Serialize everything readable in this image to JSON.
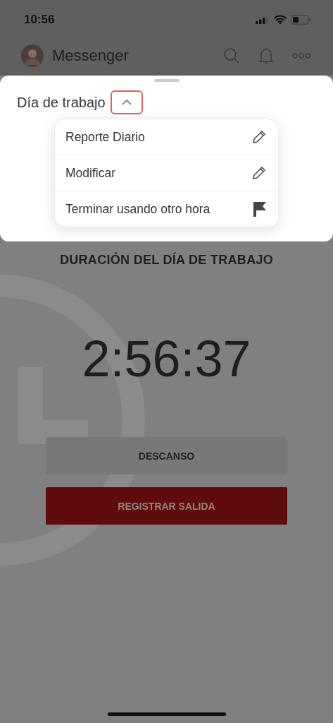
{
  "status_bar": {
    "time": "10:56"
  },
  "header": {
    "title": "Messenger"
  },
  "sheet": {
    "title": "Día de trabajo",
    "expanded": true,
    "menu": [
      {
        "label": "Reporte Diario",
        "kind": "pencil"
      },
      {
        "label": "Modificar",
        "kind": "pencil"
      },
      {
        "label": "Terminar usando otro hora",
        "kind": "flag"
      }
    ]
  },
  "main": {
    "heading": "DURACIÓN DEL DÍA DE TRABAJO",
    "timer": "2:56:37",
    "buttons": [
      {
        "label": "DESCANSO",
        "kind": "secondary"
      },
      {
        "label": "REGISTRAR SALIDA",
        "kind": "primary"
      }
    ]
  }
}
